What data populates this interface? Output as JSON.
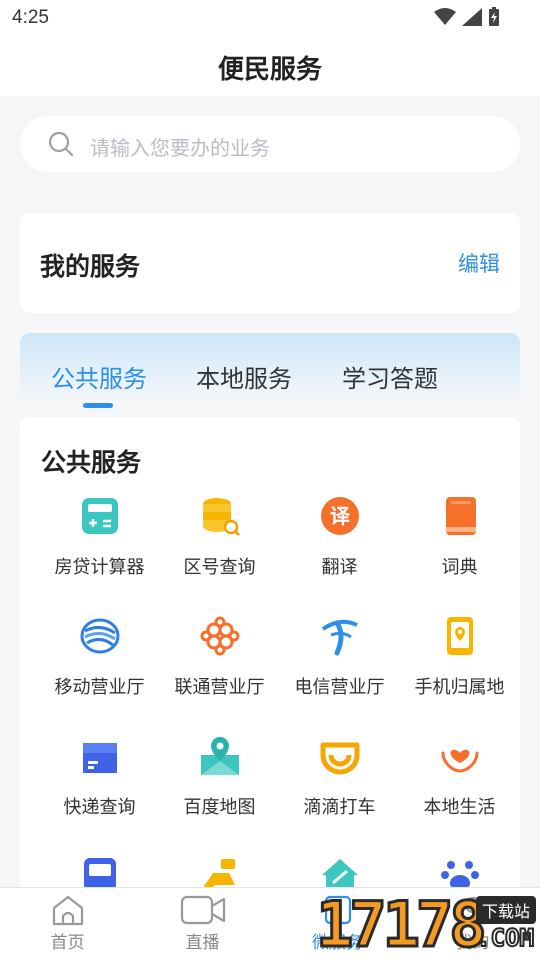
{
  "status": {
    "time": "4:25"
  },
  "header": {
    "title": "便民服务"
  },
  "search": {
    "placeholder": "请输入您要办的业务"
  },
  "my_service": {
    "title": "我的服务",
    "edit_label": "编辑"
  },
  "tabs": [
    {
      "label": "公共服务",
      "active": true
    },
    {
      "label": "本地服务",
      "active": false
    },
    {
      "label": "学习答题",
      "active": false
    }
  ],
  "panel": {
    "title": "公共服务",
    "items": [
      {
        "label": "房贷计算器",
        "icon": "calculator-icon"
      },
      {
        "label": "区号查询",
        "icon": "database-search-icon"
      },
      {
        "label": "翻译",
        "icon": "translate-icon"
      },
      {
        "label": "词典",
        "icon": "dictionary-icon"
      },
      {
        "label": "移动营业厅",
        "icon": "china-mobile-icon"
      },
      {
        "label": "联通营业厅",
        "icon": "china-unicom-icon"
      },
      {
        "label": "电信营业厅",
        "icon": "china-telecom-icon"
      },
      {
        "label": "手机归属地",
        "icon": "phone-location-icon"
      },
      {
        "label": "快递查询",
        "icon": "package-icon"
      },
      {
        "label": "百度地图",
        "icon": "map-icon"
      },
      {
        "label": "滴滴打车",
        "icon": "didi-icon"
      },
      {
        "label": "本地生活",
        "icon": "heart-hands-icon"
      }
    ],
    "partial_items": [
      {
        "icon": "bus-icon"
      },
      {
        "icon": "scooter-icon"
      },
      {
        "icon": "house-icon"
      },
      {
        "icon": "paw-icon"
      }
    ]
  },
  "tabbar": [
    {
      "label": "首页",
      "icon": "home-icon",
      "active": false
    },
    {
      "label": "直播",
      "icon": "video-icon",
      "active": false
    },
    {
      "label": "微服务",
      "icon": "service-icon",
      "active": true
    },
    {
      "label": "我的",
      "icon": "profile-icon",
      "active": false
    }
  ],
  "watermark": {
    "number": "17178",
    "badge": "下载站",
    "suffix": ".COM"
  },
  "colors": {
    "accent": "#2e8ee8",
    "orange": "#f5702b",
    "teal": "#3cc6c0"
  }
}
